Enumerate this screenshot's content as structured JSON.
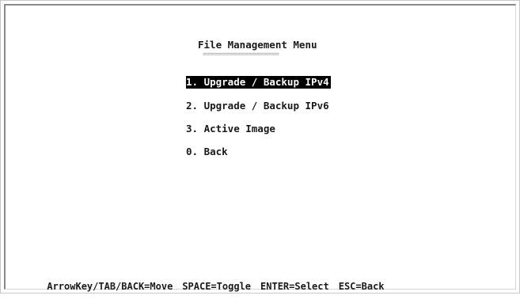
{
  "menu": {
    "title": "File Management Menu",
    "title_underline": "====================",
    "items": [
      {
        "label": "1. Upgrade / Backup IPv4",
        "selected": true
      },
      {
        "label": "2. Upgrade / Backup IPv6",
        "selected": false
      },
      {
        "label": "3. Active Image",
        "selected": false
      },
      {
        "label": "0. Back",
        "selected": false
      }
    ]
  },
  "hint_bar": {
    "items": [
      "ArrowKey/TAB/BACK=Move",
      "SPACE=Toggle",
      "ENTER=Select",
      "ESC=Back"
    ]
  },
  "colors": {
    "background": "#ffffff",
    "text": "#1a1a1a",
    "selected_background": "#000000",
    "selected_text": "#ffffff"
  }
}
